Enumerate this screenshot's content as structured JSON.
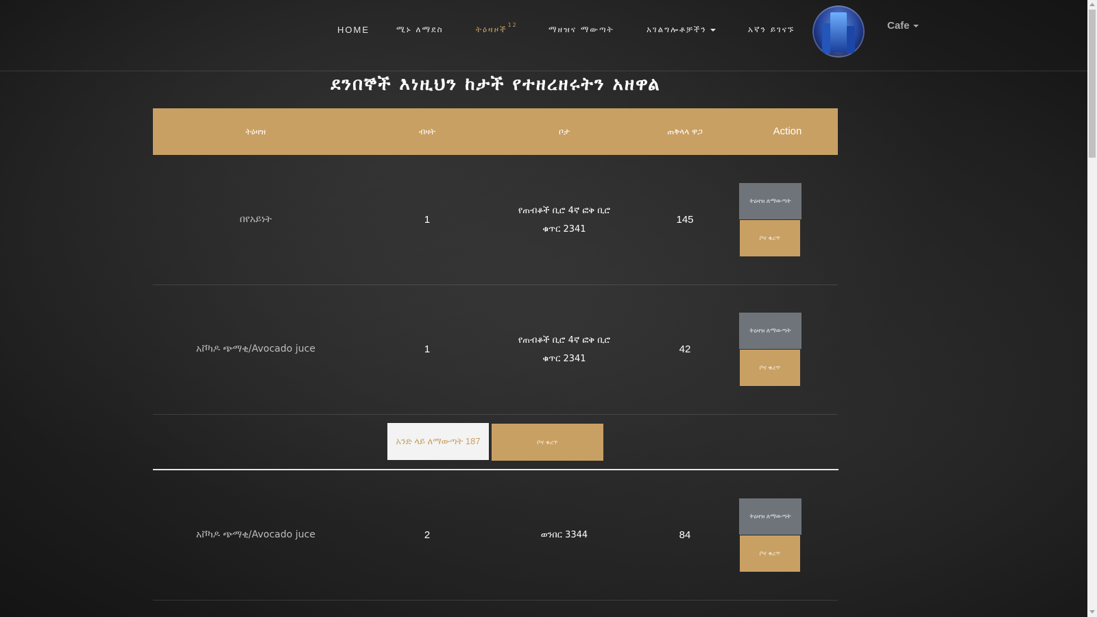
{
  "nav": {
    "home": "HOME",
    "about": "ሚኑ ለማደስ",
    "orders": "ትዕዛዞች",
    "orders_count": "12",
    "delivery": "ማዘዝና ማውጣት",
    "services": "አገልግሎቶቻችን",
    "contact": "አኛን ይገናኙ",
    "user_menu": "Cafe"
  },
  "page_title": "ደንበኞች እነዚህን ከታች የተዘረዘሩትን አዘዋል",
  "table": {
    "headers": [
      "ትዕዛዝ",
      "ብዛት",
      "ቦታ",
      "ጠቅላላ ዋጋ",
      "Action"
    ],
    "rows": [
      {
        "item": "በየአይነት",
        "qty": "1",
        "place_line1": "የጠብቆች ቢሮ 4ኛ ፎቅ ቢሮ",
        "place_line2": "ቁጥር 2341",
        "total": "145",
        "view_label": "ትዕዛዝ ለማውጣት",
        "pay_label": "ቦና ቁረጥ"
      },
      {
        "item": "አቮካዶ ጭማቂ/Avocado juce",
        "qty": "1",
        "place_line1": "የጠብቆች ቢሮ 4ኛ ፎቅ ቢሮ",
        "place_line2": "ቁጥር 2341",
        "total": "42",
        "view_label": "ትዕዛዝ ለማውጣት",
        "pay_label": "ቦና ቁረጥ"
      },
      {
        "item": "አቮካዶ ጭማቂ/Avocado juce",
        "qty": "2",
        "place_line1": "ወንበር 3344",
        "place_line2": "",
        "total": "84",
        "view_label": "ትዕዛዝ ለማውጣት",
        "pay_label": "ቦና ቁረጥ"
      }
    ]
  },
  "group_actions": {
    "view_all_label": "አንድ ላይ ለማውጣት 187",
    "pay_all_label": "ቦና ቁረጥ"
  },
  "colors": {
    "accent": "#c9a063",
    "header_bg": "#c9a063",
    "view_button_bg": "#6e747a",
    "background": "#232323"
  },
  "icons": {
    "avatar": "avatar-image",
    "dropdown": "chevron-down-icon"
  }
}
